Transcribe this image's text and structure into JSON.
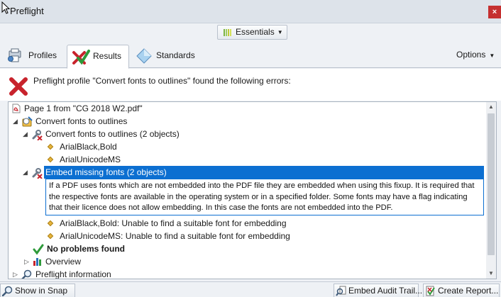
{
  "window": {
    "title": "Preflight",
    "close_glyph": "×"
  },
  "toolbar": {
    "essentials_label": "Essentials",
    "essentials_icon": "bars-icon"
  },
  "tabs": [
    {
      "label": "Profiles",
      "icon": "profiles-icon",
      "active": false
    },
    {
      "label": "Results",
      "icon": "results-check-icon",
      "active": true
    },
    {
      "label": "Standards",
      "icon": "standards-diamond-icon",
      "active": false
    }
  ],
  "options_label": "Options",
  "error_header": {
    "message": "Preflight profile \"Convert fonts to outlines\" found the following errors:",
    "icon": "red-x-icon",
    "color": "#c8232c"
  },
  "tree": {
    "page": "Page 1 from \"CG 2018 W2.pdf\"",
    "profile": "Convert fonts to outlines",
    "fixup1": "Convert fonts to outlines (2 objects)",
    "fixup1_items": [
      "ArialBlack,Bold",
      "ArialUnicodeMS"
    ],
    "fixup2": "Embed missing fonts (2 objects)",
    "fixup2_desc": "If a PDF uses fonts which are not embedded into the PDF file they are embedded when using this fixup. It is required that the respective fonts are available in the operating system or in a specified folder. Some fonts may have a flag indicating that their licence does not allow embedding. In this case the fonts are not embedded into the PDF.",
    "fixup2_items": [
      "ArialBlack,Bold: Unable to find a suitable font for embedding",
      "ArialUnicodeMS: Unable to find a suitable font for embedding"
    ],
    "no_problems": "No problems found",
    "overview": "Overview",
    "info": "Preflight information"
  },
  "bottom": {
    "show_in_snap": "Show in Snap",
    "embed_audit": "Embed Audit Trail...",
    "create_report": "Create Report..."
  },
  "colors": {
    "selection": "#0c6fd1",
    "panel": "#eef1f5",
    "accent_green": "#2e9a3a"
  }
}
